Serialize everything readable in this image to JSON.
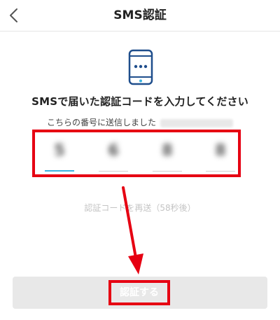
{
  "header": {
    "title": "SMS認証",
    "back_icon": "chevron-left-icon"
  },
  "main": {
    "headline": "SMSで届いた認証コードを入力してください",
    "sent_to_label": "こちらの番号に送信しました",
    "code_digits": [
      "5",
      "6",
      "8",
      "8"
    ],
    "resend_label": "認証コードを再送（58秒後）"
  },
  "footer": {
    "submit_label": "認証する"
  },
  "colors": {
    "highlight": "#e60012",
    "active_underline": "#3ab2e0",
    "phone_icon": "#1f4e8c",
    "phone_dot": "#3ab2e0",
    "disabled_button": "#e8e8e8"
  }
}
